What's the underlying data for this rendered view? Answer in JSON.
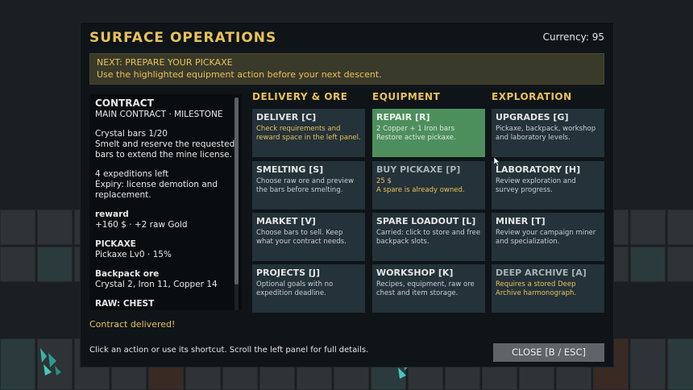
{
  "header": {
    "title": "SURFACE OPERATIONS",
    "currency": "Currency: 95"
  },
  "banner": {
    "heading": "NEXT: PREPARE YOUR PICKAXE",
    "body": "Use the highlighted equipment action before your next descent."
  },
  "contract": {
    "title": "CONTRACT",
    "subtitle": "MAIN CONTRACT · MILESTONE",
    "crystal_line": "Crystal bars 1/20",
    "desc_1": "Smelt and reserve the requested",
    "desc_2": "bars to extend the mine license.",
    "expeditions": "4 expeditions left",
    "expiry_1": "Expiry: license demotion and",
    "expiry_2": "replacement.",
    "reward_label": "reward",
    "reward_value": "+160 $ · +2 raw Gold",
    "pickaxe_label": "PICKAXE",
    "pickaxe_value": "Pickaxe Lv0 · 15%",
    "backpack_label": "Backpack ore",
    "backpack_value": "Crystal 2, Iron 11, Copper 14",
    "raw_label": "RAW: CHEST"
  },
  "status": {
    "delivered": "Contract delivered!"
  },
  "footer": {
    "hint": "Click an action or use its shortcut. Scroll the left panel for full details.",
    "close_label": "CLOSE [B / ESC]"
  },
  "columns": {
    "delivery": "DELIVERY & ORE",
    "equipment": "EQUIPMENT",
    "exploration": "EXPLORATION"
  },
  "actions": {
    "deliver": {
      "title": "DELIVER [C]",
      "desc": "Check requirements and reward space in the left panel."
    },
    "repair": {
      "title": "REPAIR [R]",
      "desc_1": "2 Copper + 1 Iron bars",
      "desc_2": "Restore active pickaxe."
    },
    "upgrades": {
      "title": "UPGRADES [G]",
      "desc": "Pickaxe, backpack, workshop and laboratory levels."
    },
    "smelting": {
      "title": "SMELTING [S]",
      "desc": "Choose raw ore and preview the bars before smelting."
    },
    "buy_pickaxe": {
      "title": "BUY PICKAXE [P]",
      "desc_1": "25 $",
      "desc_2": "A spare is already owned."
    },
    "laboratory": {
      "title": "LABORATORY [H]",
      "desc": "Review exploration and survey progress."
    },
    "market": {
      "title": "MARKET [V]",
      "desc": "Choose bars to sell. Keep what your contract needs."
    },
    "spare_loadout": {
      "title": "SPARE LOADOUT [L]",
      "desc": "Carried: click to store and free backpack slots."
    },
    "miner": {
      "title": "MINER [T]",
      "desc": "Review your campaign miner and specialization."
    },
    "projects": {
      "title": "PROJECTS [J]",
      "desc": "Optional goals with no expedition deadline."
    },
    "workshop": {
      "title": "WORKSHOP [K]",
      "desc": "Recipes, equipment, raw ore chest and item storage."
    },
    "deep_archive": {
      "title": "DEEP ARCHIVE [A]",
      "desc": "Requires a stored Deep Archive harmonograph."
    }
  },
  "colors": {
    "accent_gold": "#e8c25a",
    "highlight_green": "#4d8f5c",
    "card_bg": "#243239",
    "panel_bg": "#0f1418"
  }
}
